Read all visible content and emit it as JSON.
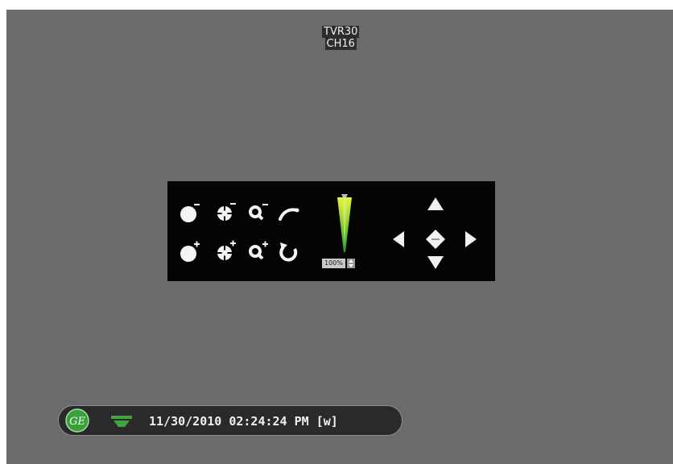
{
  "osd": {
    "device_name": "TVR30",
    "channel": "CH16"
  },
  "ptz": {
    "controls": [
      {
        "name": "iris-close",
        "icon": "iris-minus-icon"
      },
      {
        "name": "focus-near",
        "icon": "focus-minus-icon"
      },
      {
        "name": "zoom-out",
        "icon": "zoom-minus-icon"
      },
      {
        "name": "wiper",
        "icon": "wiper-icon"
      },
      {
        "name": "iris-open",
        "icon": "iris-plus-icon"
      },
      {
        "name": "focus-far",
        "icon": "focus-plus-icon"
      },
      {
        "name": "zoom-in",
        "icon": "zoom-plus-icon"
      },
      {
        "name": "auto-scan",
        "icon": "rotate-icon"
      }
    ],
    "speed_label": "100%",
    "speed_fraction": 1.0,
    "directions": [
      "up",
      "down",
      "left",
      "right",
      "home"
    ]
  },
  "status": {
    "logo": "GE",
    "datetime": "11/30/2010 02:24:24 PM [w]",
    "colors": {
      "logo_green": "#3aa13a",
      "accent_green": "#3fa33f",
      "panel_bg": "#040404",
      "video_bg": "#6b6a6d"
    }
  }
}
